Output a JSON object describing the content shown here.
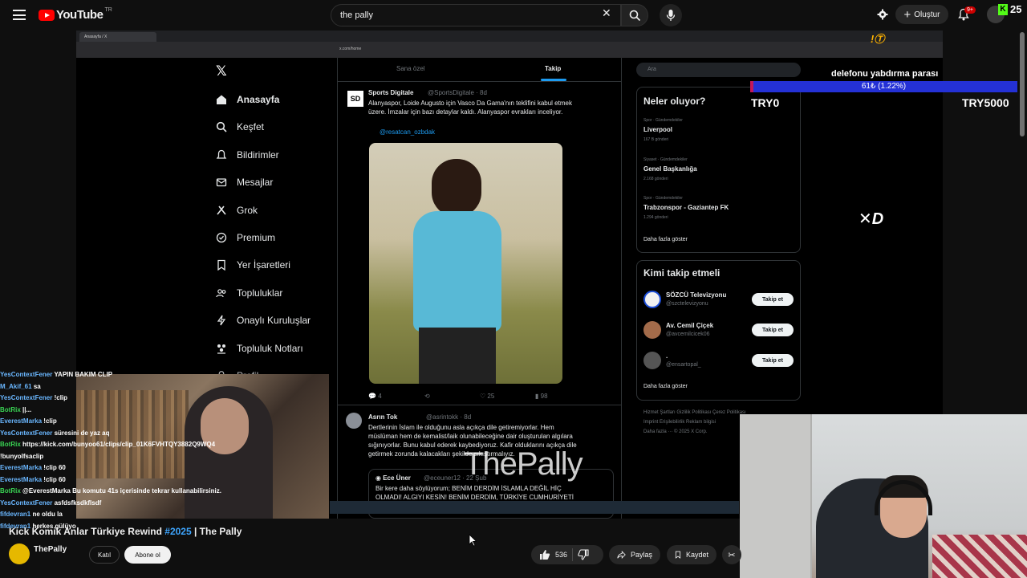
{
  "header": {
    "logo_text": "YouTube",
    "logo_region": "TR",
    "search_query": "the pally",
    "create_label": "Oluştur",
    "notifications_badge": "9+"
  },
  "stream_overlay": {
    "watermark": "ThePally",
    "donation_title": "delefonu yabdırma parası",
    "donation_progress": "61₺ (1.22%)",
    "donation_fraction": 0.0122,
    "goal_min": "TRY0",
    "goal_max": "TRY5000",
    "kick_viewers": "25"
  },
  "browser": {
    "tab_title": "Anasayfa / X",
    "url": "x.com/home"
  },
  "x_sidebar": {
    "items": [
      {
        "label": "Anasayfa",
        "icon": "home-icon"
      },
      {
        "label": "Keşfet",
        "icon": "search-icon"
      },
      {
        "label": "Bildirimler",
        "icon": "bell-icon"
      },
      {
        "label": "Mesajlar",
        "icon": "mail-icon"
      },
      {
        "label": "Grok",
        "icon": "grok-icon"
      },
      {
        "label": "Premium",
        "icon": "premium-icon"
      },
      {
        "label": "Yer İşaretleri",
        "icon": "bookmark-icon"
      },
      {
        "label": "Topluluklar",
        "icon": "communities-icon"
      },
      {
        "label": "Onaylı Kuruluşlar",
        "icon": "lightning-icon"
      },
      {
        "label": "Topluluk Notları",
        "icon": "notes-icon"
      },
      {
        "label": "Profil",
        "icon": "profile-icon"
      }
    ]
  },
  "feed": {
    "tabs": [
      "Sana özel",
      "Takip"
    ],
    "tweet1": {
      "name": "Sports Digitale",
      "handle": "@SportsDigitale · 8d",
      "line1": "Alanyaspor, Loide Augusto için Vasco Da Gama'nın teklifini kabul etmek",
      "line2": "üzere. İmzalar için bazı detaylar kaldı. Alanyaspor evrakları inceliyor.",
      "credit": "@resatcan_ozbdak",
      "replies": "4",
      "likes": "25",
      "views": "98"
    },
    "tweet2": {
      "name": "Asrın Tok",
      "handle": "@asrintokk · 8d",
      "line1": "Dertlerinin İslam ile olduğunu asla açıkça dile getiremiyorlar. Hem",
      "line2": "müslüman hem de kemalist/laik olunabileceğine dair oluşturulan algılara",
      "line3": "sığınıyorlar. Bunu kabul ederek kaybediyoruz. Kafir olduklarını açıkça dile",
      "line4": "getirmek zorunda kalacakları şekilde sıkıştırmalıyız.",
      "quote_name": "Ece Üner",
      "quote_handle": "@eceuner12 · 22 Şub",
      "quote_line1": "Bir kere daha söylüyorum; BENİM DERDİM İSLAMLA DEĞİL HİÇ",
      "quote_line2": "OLMADI! ALGIYI KESİN! BENİM DERDİM, TÜRKİYE CUMHURİYETİ"
    }
  },
  "right_column": {
    "search_placeholder": "Ara",
    "trends_title": "Neler oluyor?",
    "trends": [
      {
        "category": "Spor · Gündemdekiler",
        "name": "Liverpool",
        "count": "167 B gönderi"
      },
      {
        "category": "Siyaset · Gündemdekiler",
        "name": "Genel Başkanlığa",
        "count": "2.168 gönderi"
      },
      {
        "category": "Spor · Gündemdekiler",
        "name": "Trabzonspor - Gaziantep FK",
        "count": "1.294 gönderi"
      }
    ],
    "trends_more": "Daha fazla göster",
    "follow_title": "Kimi takip etmeli",
    "follow": [
      {
        "name": "SÖZCÜ Televizyonu",
        "handle": "@szctelevizyonu",
        "button": "Takip et"
      },
      {
        "name": "Av. Cemil Çiçek",
        "handle": "@avcemilcicek06",
        "button": "Takip et"
      },
      {
        "name": ".",
        "handle": "@ensartopal_",
        "button": "Takip et"
      }
    ],
    "follow_more": "Daha fazla göster",
    "footer1": "Hizmet Şartları  Gizlilik Politikası  Çerez Politikası",
    "footer2": "Imprint  Erişilebilirlik  Reklam bilgisi",
    "footer3": "Daha fazla ···  © 2025 X Corp."
  },
  "chat": [
    {
      "user": "YesContextFener",
      "msg": "YAPIN BAKIM CLIP",
      "bot": false
    },
    {
      "user": "M_Akif_61",
      "msg": "sa",
      "bot": false
    },
    {
      "user": "YesContextFener",
      "msg": "!clip",
      "bot": false
    },
    {
      "user": "BotRix",
      "msg": "||...",
      "bot": true
    },
    {
      "user": "EverestMarka",
      "msg": "!clip",
      "bot": false
    },
    {
      "user": "YesContextFener",
      "msg": "süresini de yaz aq",
      "bot": false
    },
    {
      "user": "BotRix",
      "msg": "https://kick.com/bunyoo61/clips/clip_01K6FVHTQY3882Q9WQ4",
      "bot": true
    },
    {
      "user": "",
      "msg": "!bunyolfsaclip",
      "bot": false
    },
    {
      "user": "EverestMarka",
      "msg": "!clip 60",
      "bot": false
    },
    {
      "user": "EverestMarka",
      "msg": "!clip 60",
      "bot": false
    },
    {
      "user": "BotRix",
      "msg": "@EverestMarka Bu komutu 41s içerisinde tekrar kullanabilirsiniz.",
      "bot": true
    },
    {
      "user": "YesContextFener",
      "msg": "asfdsfksdkflsdf",
      "bot": false
    },
    {
      "user": "fifdevran1",
      "msg": "ne oldu la",
      "bot": false
    },
    {
      "user": "fifdevran1",
      "msg": "herkes gülüyo",
      "bot": false
    }
  ],
  "video": {
    "title_prefix": "Kick Komik Anlar Türkiye Rewind ",
    "title_tag": "#2025",
    "title_suffix": " | The Pally",
    "channel": "ThePally",
    "join_label": "Katıl",
    "subscribe_label": "Abone ol",
    "likes": "536",
    "share_label": "Paylaş",
    "save_label": "Kaydet"
  }
}
